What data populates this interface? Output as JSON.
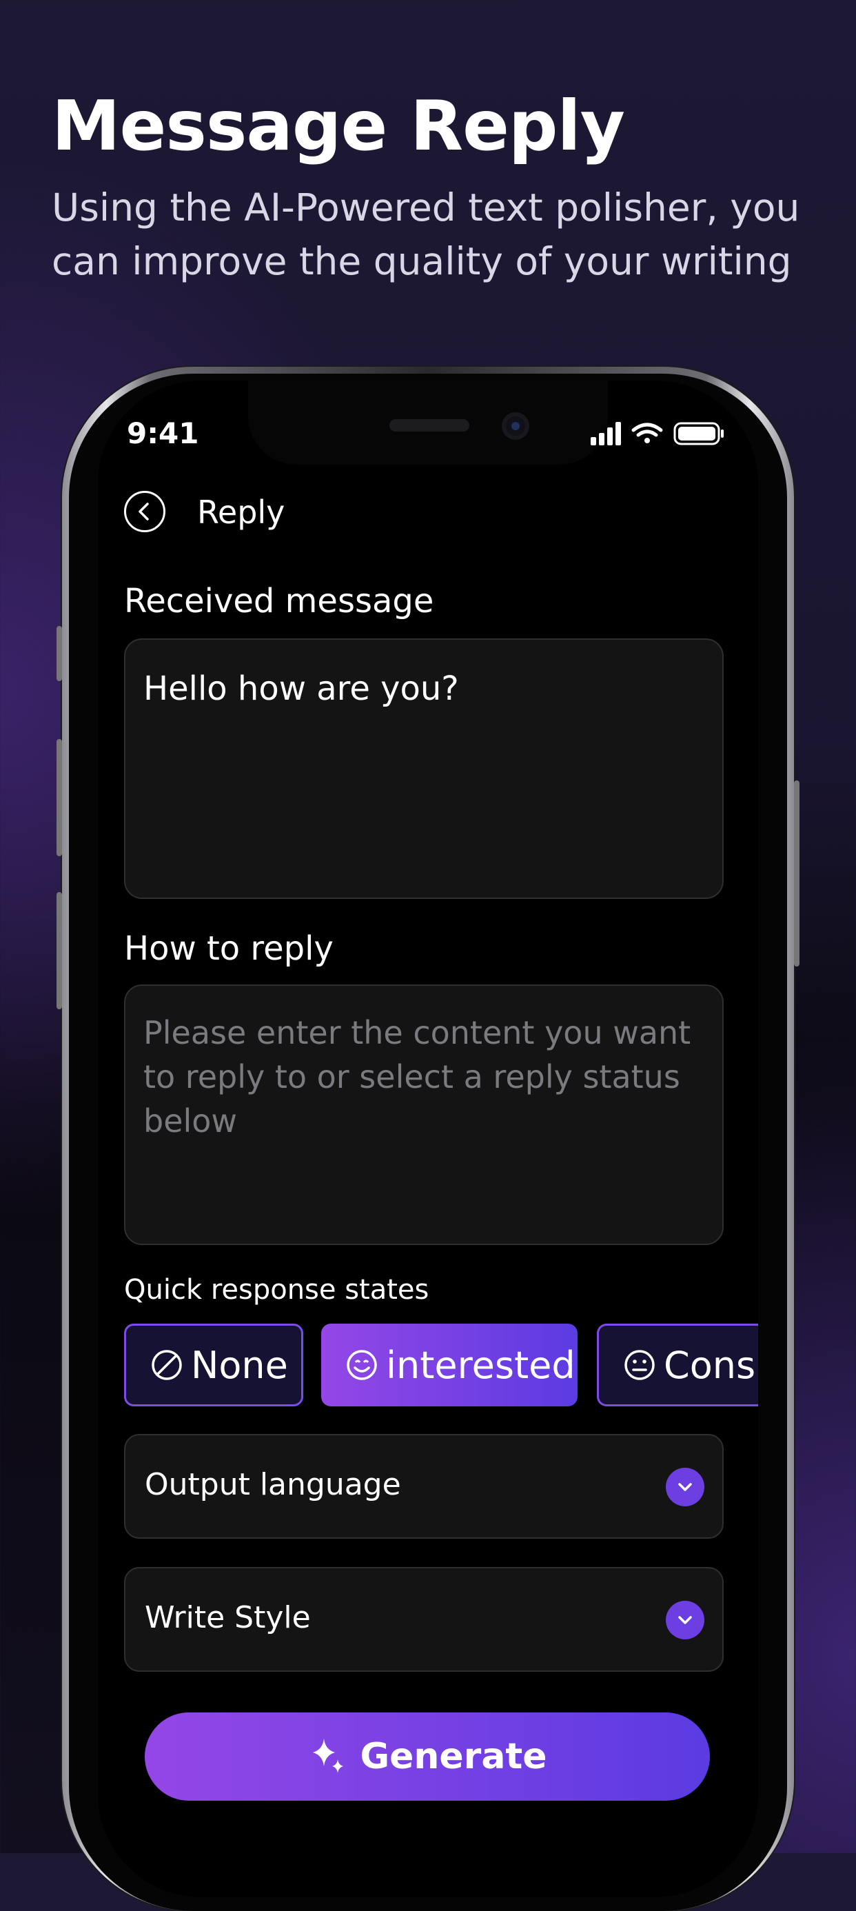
{
  "promo": {
    "title": "Message Reply",
    "subtitle": "Using the AI-Powered text polisher, you can improve the quality of your writing"
  },
  "status_bar": {
    "time": "9:41"
  },
  "nav": {
    "back_icon": "chevron-left-circle-icon",
    "title": "Reply"
  },
  "received": {
    "label": "Received message",
    "value": "Hello how are you?"
  },
  "how_to_reply": {
    "label": "How to reply",
    "placeholder": "Please enter the content you want to reply to or select a reply status below"
  },
  "quick_states": {
    "label": "Quick response states",
    "chips": [
      {
        "label": "None",
        "icon": "none-slash-icon",
        "selected": false
      },
      {
        "label": "interested",
        "icon": "smile-icon",
        "selected": true
      },
      {
        "label": "Consi",
        "icon": "neutral-face-icon",
        "selected": false
      }
    ]
  },
  "output_language": {
    "label": "Output language",
    "icon": "chevron-down-icon"
  },
  "write_style": {
    "label": "Write Style",
    "icon": "chevron-down-icon"
  },
  "generate": {
    "label": "Generate",
    "icon": "sparkle-icon"
  },
  "colors": {
    "accent_start": "#9447e6",
    "accent_end": "#5b3be2",
    "chip_border": "#7c4ce6",
    "field_bg": "#141414"
  }
}
